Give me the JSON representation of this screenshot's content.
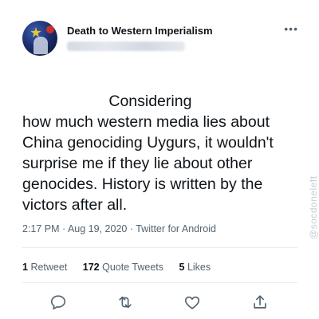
{
  "tweet": {
    "author": {
      "display_name": "Death to Western Imperialism",
      "handle": ""
    },
    "more_icon": "more-horizontal-icon",
    "text": "                    Considering\nhow much western media lies about China genociding Uygurs, it wouldn't surprise me if they lie about other genocides. History is written by the victors after all.",
    "meta": "2:17 PM · Aug 19, 2020 · Twitter for Android",
    "stats": {
      "retweets_count": "1",
      "retweets_label": "Retweet",
      "quotes_count": "172",
      "quotes_label": "Quote Tweets",
      "likes_count": "5",
      "likes_label": "Likes"
    },
    "actions": [
      "reply-icon",
      "retweet-icon",
      "like-icon",
      "share-icon"
    ]
  },
  "watermark": "@socdoneleft",
  "colors": {
    "text": "#0f1419",
    "secondary": "#536471",
    "divider": "#e6ecf0"
  }
}
